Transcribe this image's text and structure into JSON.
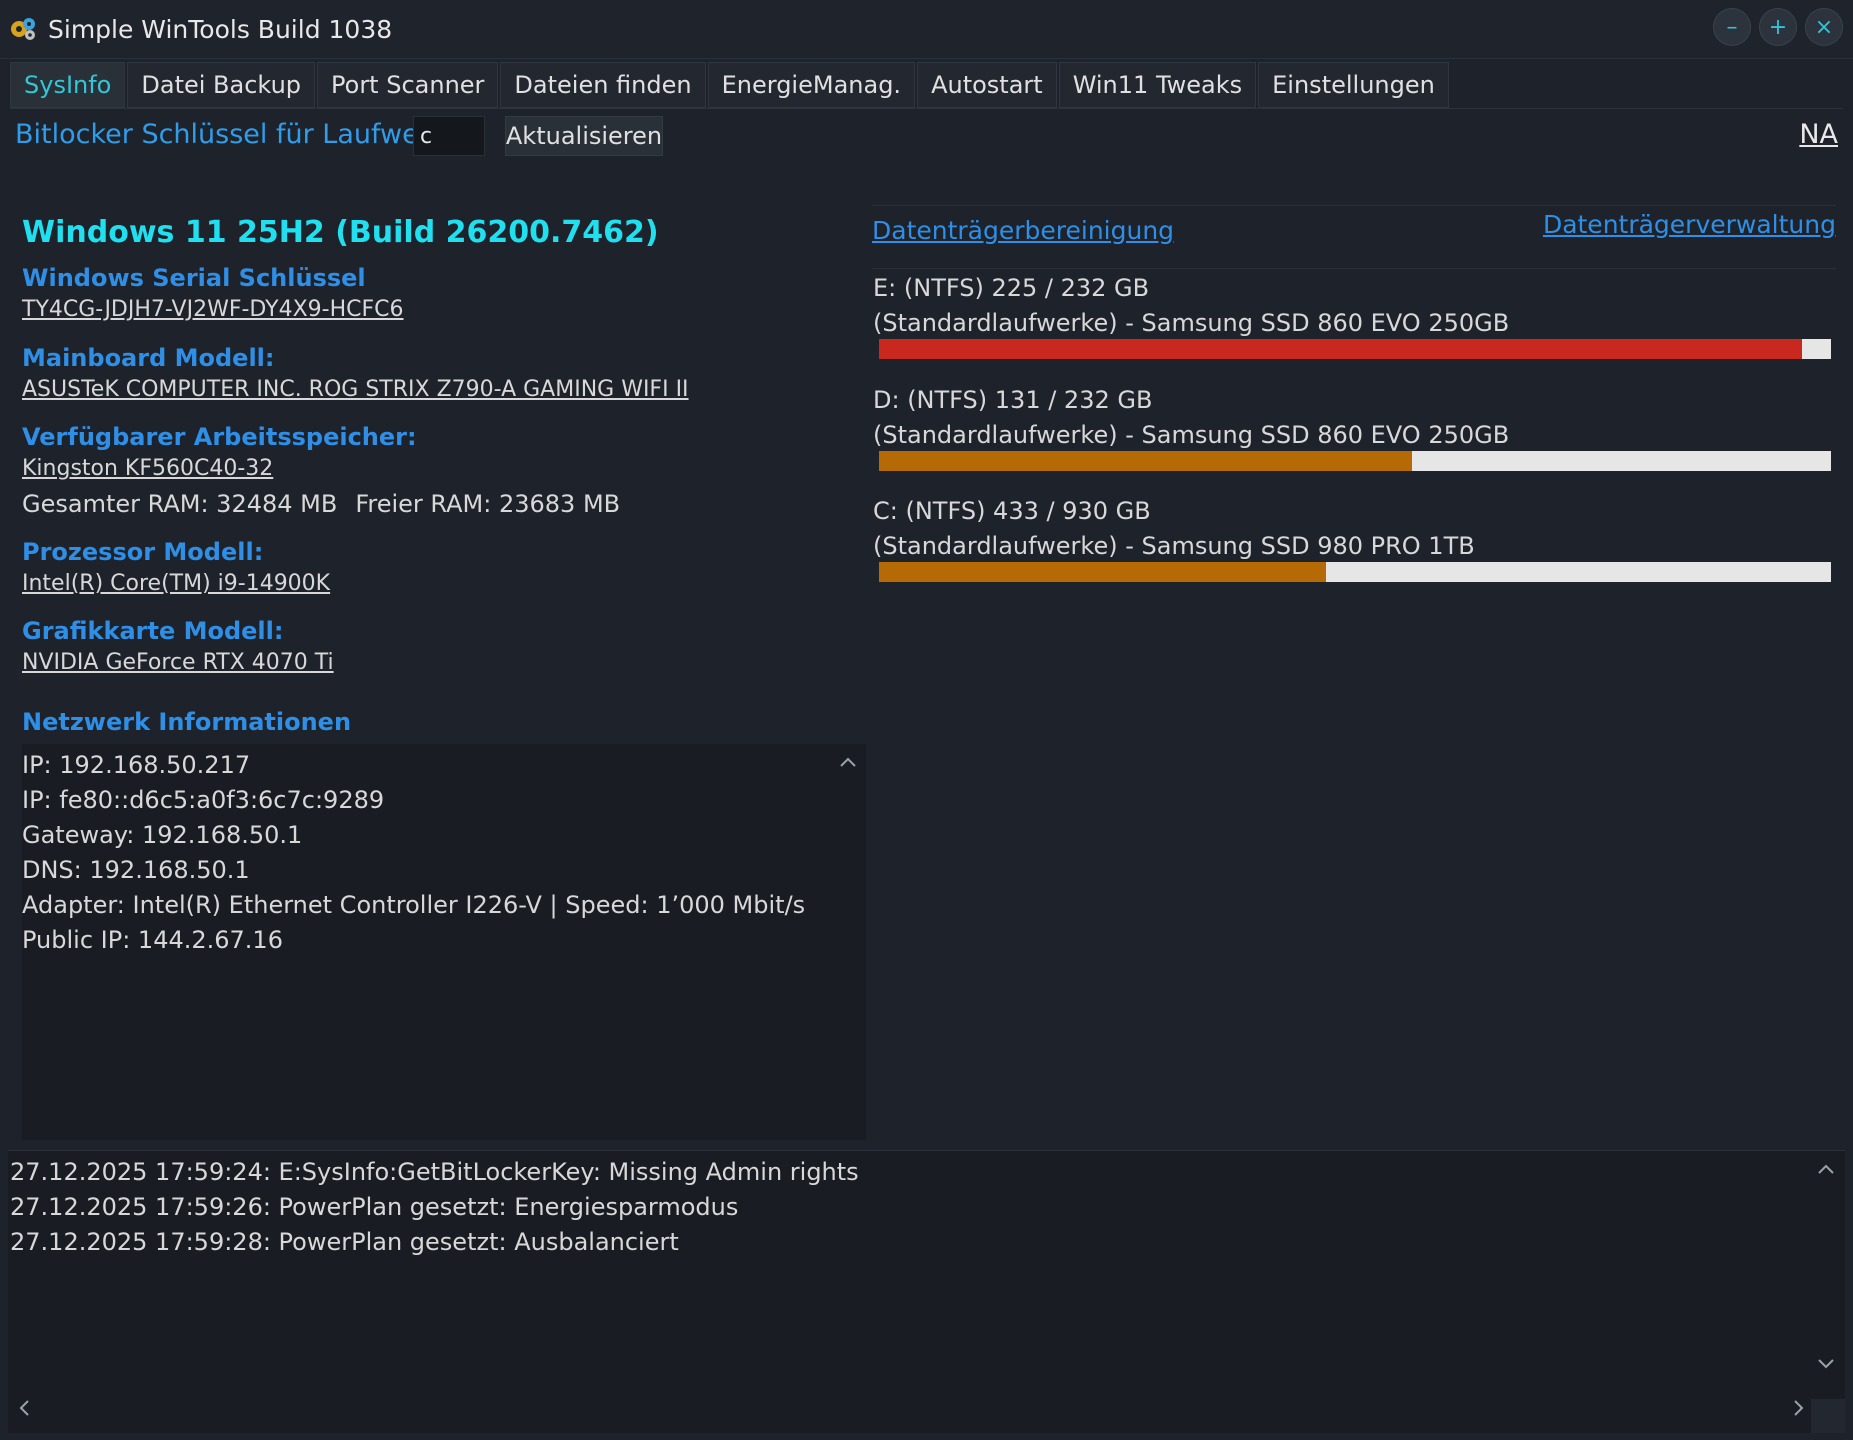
{
  "window": {
    "title": "Simple WinTools Build 1038",
    "minimize": "–",
    "maximize": "+",
    "close": "×"
  },
  "tabs": [
    {
      "label": "SysInfo",
      "active": true
    },
    {
      "label": "Datei Backup"
    },
    {
      "label": "Port Scanner"
    },
    {
      "label": "Dateien finden"
    },
    {
      "label": "EnergieManag."
    },
    {
      "label": "Autostart"
    },
    {
      "label": "Win11 Tweaks"
    },
    {
      "label": "Einstellungen"
    }
  ],
  "bitlocker": {
    "label": "Bitlocker Schlüssel für Laufwerk:",
    "drive_value": "c",
    "refresh_label": "Aktualisieren",
    "result": "NA"
  },
  "sysinfo": {
    "os": "Windows 11 25H2 (Build 26200.7462)",
    "serial_label": "Windows Serial Schlüssel",
    "serial_value": "TY4CG-JDJH7-VJ2WF-DY4X9-HCFC6",
    "mainboard_label": "Mainboard Modell:",
    "mainboard_value": "ASUSTeK COMPUTER INC. ROG STRIX Z790-A GAMING WIFI II",
    "ram_label": "Verfügbarer Arbeitsspeicher:",
    "ram_value": "Kingston KF560C40-32",
    "ram_total": "Gesamter RAM: 32484 MB",
    "ram_free": "Freier RAM: 23683 MB",
    "cpu_label": "Prozessor Modell:",
    "cpu_value": "Intel(R) Core(TM) i9-14900K",
    "gpu_label": "Grafikkarte Modell:",
    "gpu_value": "NVIDIA GeForce RTX 4070 Ti",
    "network_label": "Netzwerk Informationen"
  },
  "network_lines": [
    "IP: 192.168.50.217",
    "IP: fe80::d6c5:a0f3:6c7c:9289",
    "Gateway: 192.168.50.1",
    "DNS: 192.168.50.1",
    "Adapter: Intel(R) Ethernet Controller I226-V | Speed: 1’000 Mbit/s",
    "Public IP: 144.2.67.16"
  ],
  "drive_links": {
    "cleanup": "Datenträgerbereinigung",
    "management": "Datenträgerverwaltung"
  },
  "drives": [
    {
      "line1": "E: (NTFS)  225 / 232 GB",
      "line2": "(Standardlaufwerke) - Samsung SSD 860 EVO 250GB",
      "used_fraction": 0.97,
      "color": "#c8281e"
    },
    {
      "line1": "D: (NTFS)  131 / 232 GB",
      "line2": "(Standardlaufwerke) - Samsung SSD 860 EVO 250GB",
      "used_fraction": 0.56,
      "color": "#b56a05"
    },
    {
      "line1": "C: (NTFS)  433 / 930 GB",
      "line2": "(Standardlaufwerke) - Samsung SSD 980 PRO 1TB",
      "used_fraction": 0.47,
      "color": "#b56a05"
    }
  ],
  "log_lines": [
    "27.12.2025 17:59:24: E:SysInfo:GetBitLockerKey: Missing Admin rights",
    "27.12.2025 17:59:26: PowerPlan gesetzt: Energiesparmodus",
    "27.12.2025 17:59:28: PowerPlan gesetzt: Ausbalanciert"
  ],
  "icons": {
    "app": "gears-icon",
    "scroll_up": "chevron-up-icon",
    "scroll_down": "chevron-down-icon",
    "scroll_left": "chevron-left-icon",
    "scroll_right": "chevron-right-icon"
  }
}
